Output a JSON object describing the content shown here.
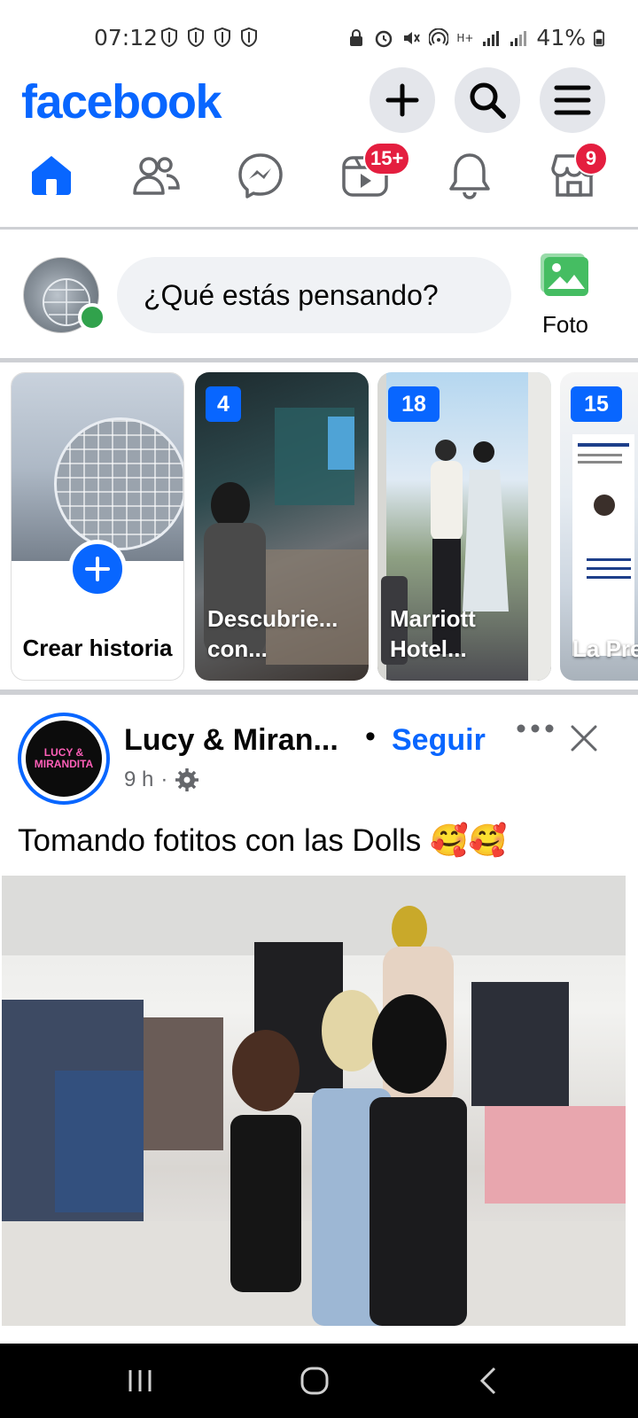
{
  "status_bar": {
    "time": "07:12",
    "battery": "41%",
    "network": "H+"
  },
  "header": {
    "logo": "facebook",
    "brand_color": "#0866ff",
    "buttons": [
      "plus-icon",
      "search-icon",
      "menu-icon"
    ]
  },
  "nav": {
    "tabs": [
      {
        "name": "home",
        "icon": "home-icon",
        "active": true
      },
      {
        "name": "friends",
        "icon": "friends-icon"
      },
      {
        "name": "messenger",
        "icon": "messenger-icon"
      },
      {
        "name": "video",
        "icon": "video-icon",
        "badge": "15+"
      },
      {
        "name": "notifications",
        "icon": "bell-icon"
      },
      {
        "name": "marketplace",
        "icon": "marketplace-icon",
        "badge": "9"
      }
    ]
  },
  "composer": {
    "placeholder": "¿Qué estás pensando?",
    "photo_label": "Foto"
  },
  "stories": {
    "create_label": "Crear historia",
    "items": [
      {
        "count": "4",
        "title": "Descubrie... con..."
      },
      {
        "count": "18",
        "title": "Marriott Hotel..."
      },
      {
        "count": "15",
        "title": "La Pren"
      }
    ]
  },
  "post": {
    "page_name": "Lucy & Miran...",
    "avatar_text": "LUCY & MIRANDITA",
    "separator": "•",
    "follow_label": "Seguir",
    "time": "9 h",
    "text": "Tomando fotitos con las Dolls 🥰🥰"
  }
}
